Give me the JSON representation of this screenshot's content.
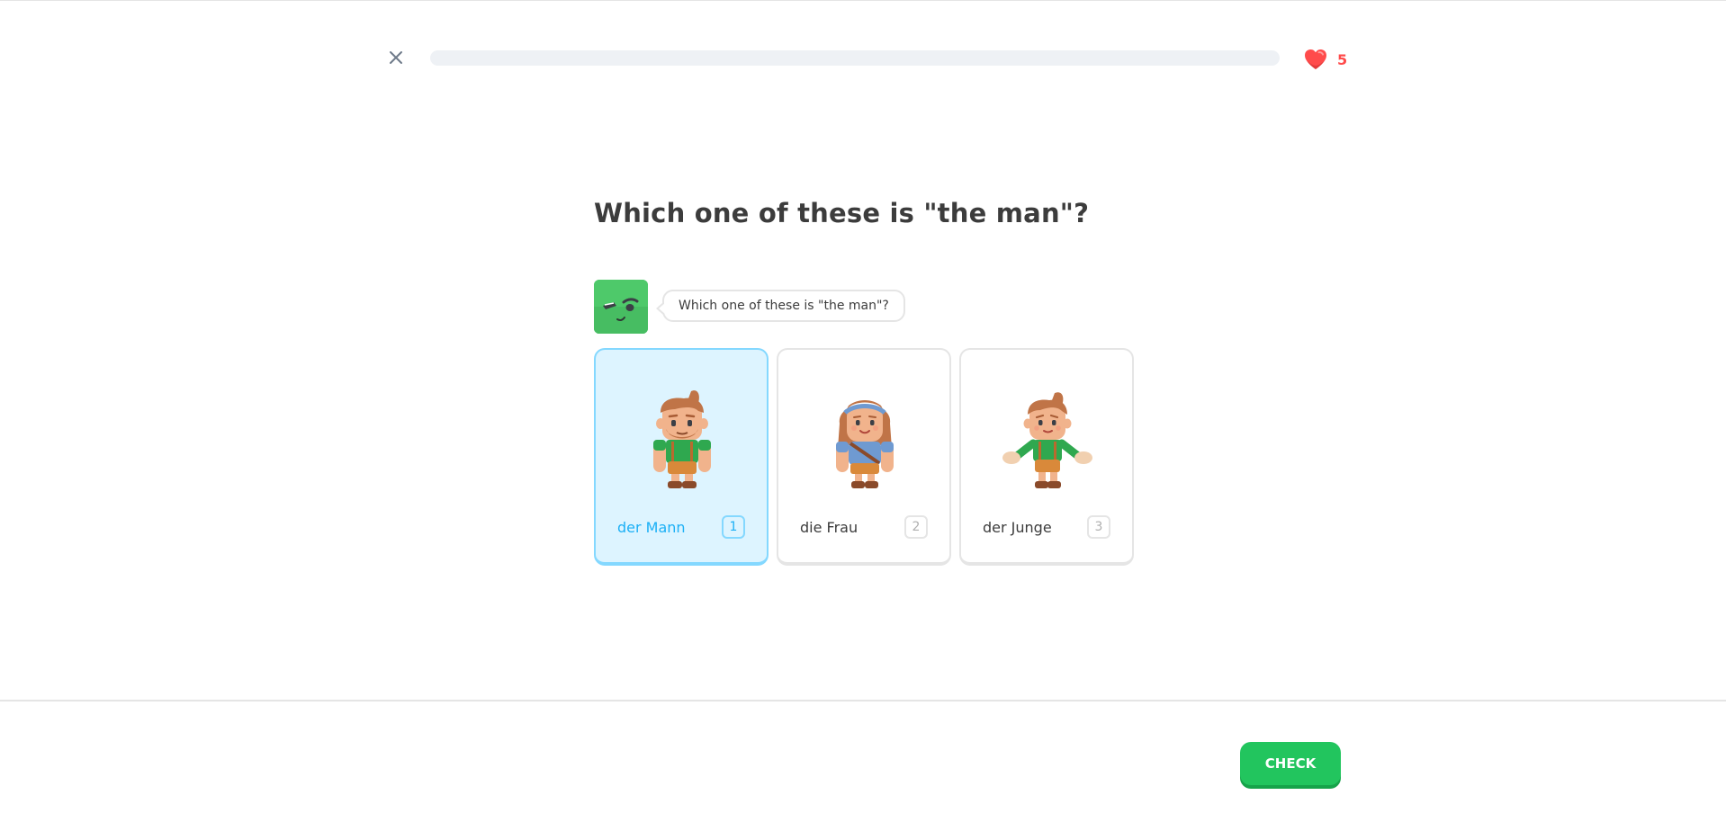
{
  "header": {
    "close_icon": "close-icon",
    "progress": 0,
    "hearts_icon": "heart-icon",
    "hearts_count": "5"
  },
  "prompt": {
    "title": "Which one of these is \"the man\"?",
    "bubble_text": "Which one of these is \"the man\"?"
  },
  "choices": [
    {
      "label": "der Mann",
      "key": "1",
      "selected": true
    },
    {
      "label": "die Frau",
      "key": "2",
      "selected": false
    },
    {
      "label": "der Junge",
      "key": "3",
      "selected": false
    }
  ],
  "footer": {
    "check_label": "CHECK"
  },
  "colors": {
    "selected_bg": "#ddf4ff",
    "selected_border": "#84d8ff",
    "selected_text": "#1cb0f6",
    "check_button": "#22c55e",
    "hearts": "#ff4b4b"
  }
}
